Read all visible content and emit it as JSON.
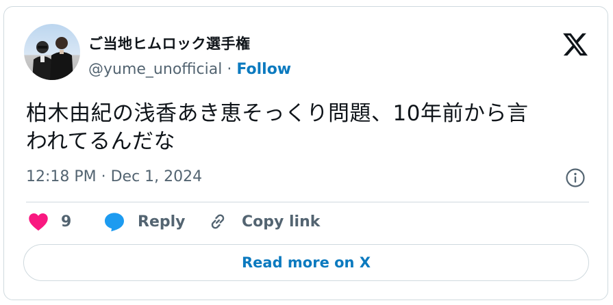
{
  "author": {
    "display_name": "ご当地ヒムロック選手権",
    "handle": "@yume_unofficial",
    "separator": "·",
    "follow_label": "Follow"
  },
  "tweet": {
    "text_line1": "柏木由紀の浅香あき恵そっくり問題、10年前から言",
    "text_line2": "われてるんだな",
    "timestamp": "12:18 PM · Dec 1, 2024"
  },
  "actions": {
    "like_count": "9",
    "reply_label": "Reply",
    "copy_link_label": "Copy link"
  },
  "read_more_label": "Read more on X",
  "colors": {
    "accent": "#0c7abf",
    "heart": "#f91880",
    "reply_bubble": "#1d9bf0",
    "muted": "#536471",
    "border": "#cfd9de"
  },
  "icons": [
    "x-logo-icon",
    "info-icon",
    "heart-icon",
    "reply-icon",
    "link-icon"
  ]
}
